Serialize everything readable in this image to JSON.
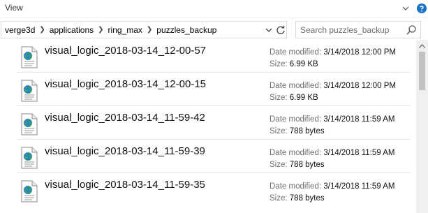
{
  "ribbon": {
    "view_tab": "View"
  },
  "address": {
    "crumbs": [
      "verge3d",
      "applications",
      "ring_max",
      "puzzles_backup"
    ]
  },
  "search": {
    "placeholder": "Search puzzles_backup"
  },
  "meta_labels": {
    "modified": "Date modified:",
    "size": "Size:"
  },
  "files": [
    {
      "name": "visual_logic_2018-03-14_12-00-57",
      "modified": "3/14/2018 12:00 PM",
      "size": "6.99 KB"
    },
    {
      "name": "visual_logic_2018-03-14_12-00-15",
      "modified": "3/14/2018 12:00 PM",
      "size": "6.99 KB"
    },
    {
      "name": "visual_logic_2018-03-14_11-59-42",
      "modified": "3/14/2018 11:59 AM",
      "size": "788 bytes"
    },
    {
      "name": "visual_logic_2018-03-14_11-59-39",
      "modified": "3/14/2018 11:59 AM",
      "size": "788 bytes"
    },
    {
      "name": "visual_logic_2018-03-14_11-59-35",
      "modified": "3/14/2018 11:59 AM",
      "size": "788 bytes"
    }
  ],
  "colors": {
    "help_blue": "#1a73c9",
    "globe_blue": "#2e7fd4",
    "globe_green": "#35a34a"
  },
  "icons": {
    "collapse": "chevron-down-icon",
    "help": "help-icon",
    "breadcrumb_separator": "chevron-right-icon",
    "address_dropdown": "chevron-down-icon",
    "refresh": "refresh-icon",
    "search": "search-icon",
    "file": "web-document-icon",
    "scroll_up": "arrow-up-icon"
  }
}
